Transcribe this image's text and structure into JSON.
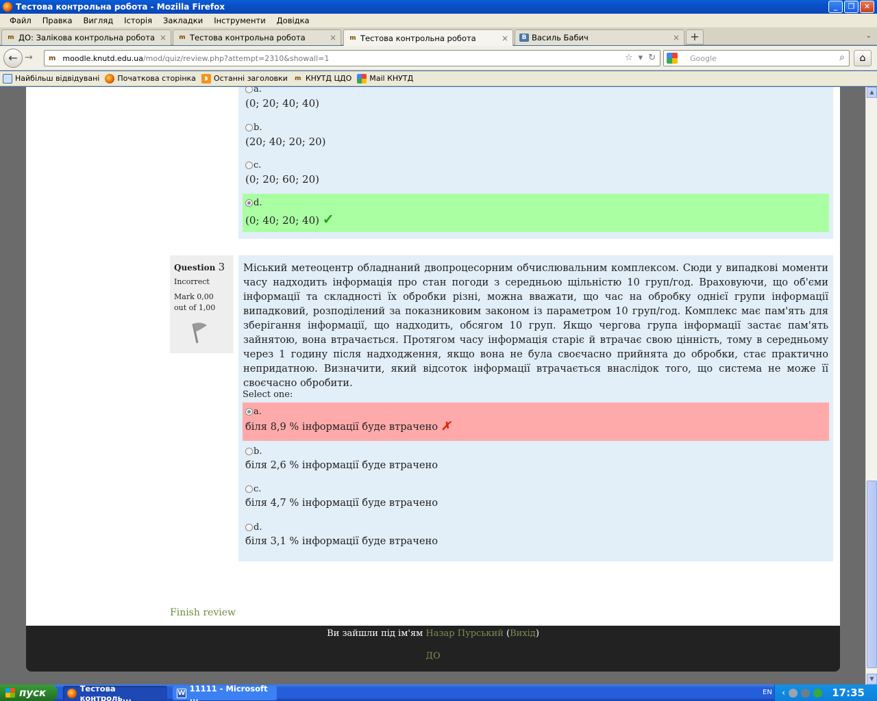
{
  "window": {
    "title": "Тестова контрольна робота - Mozilla Firefox",
    "buttons": [
      "_",
      "❐",
      "✕"
    ]
  },
  "menu": [
    "Файл",
    "Правка",
    "Вигляд",
    "Історія",
    "Закладки",
    "Інструменти",
    "Довідка"
  ],
  "tabs": [
    {
      "label": "ДО: Залікова контрольна робота",
      "icon": "moodle-icon"
    },
    {
      "label": "Тестова контрольна робота",
      "icon": "moodle-icon"
    },
    {
      "label": "Тестова контрольна робота",
      "icon": "moodle-icon",
      "active": true
    },
    {
      "label": "Василь Бабич",
      "icon": "vk-icon"
    }
  ],
  "nav": {
    "url_host": "moodle.knutd.edu.ua",
    "url_path": "/mod/quiz/review.php?attempt=2310&showall=1",
    "search_placeholder": "Google"
  },
  "bookmarks": [
    "Найбільш відвідувані",
    "Початкова сторінка",
    "Останні заголовки",
    "КНУТД ЦДО",
    "Mail КНУТД"
  ],
  "question2": {
    "answers": [
      {
        "letter": "a.",
        "text": "(0; 20; 40; 40)",
        "state": "none"
      },
      {
        "letter": "b.",
        "text": "(20; 40; 20; 20)",
        "state": "none"
      },
      {
        "letter": "c.",
        "text": "(0; 20; 60; 20)",
        "state": "none"
      },
      {
        "letter": "d.",
        "text": "(0; 40; 20; 40)",
        "state": "correct"
      }
    ],
    "tick": "✓"
  },
  "question3": {
    "label": "Question",
    "number": "3",
    "state": "Incorrect",
    "mark_line1": "Mark 0,00",
    "mark_line2": "out of 1,00",
    "text": "Міський метеоцентр обладнаний двопроцесорним обчислювальним комплексом. Сюди у випадкові моменти часу надходить інформація про стан погоди з середньою щільністю 10 груп/год. Враховуючи, що об'єми інформації та складності їх обробки різні, можна вважати, що час на обробку однієї групи інформації випадковий, розподілений за показниковим законом із параметром 10 груп/год. Комплекс має пам'ять для зберігання інформації, що надходить, обсягом 10 груп. Якщо чергова група інформації застає пам'ять зайнятою, вона втрачається. Протягом часу інформація старіє й втрачає свою цінність, тому в середньому через 1 годину після надходження, якщо вона не була своєчасно прийнята до обробки, стає практично непридатною. Визначити, який відсоток інформації втрачається внаслідок того, що система не може її своєчасно обробити.",
    "select_one": "Select one:",
    "answers": [
      {
        "letter": "a.",
        "text": "біля 8,9 % інформації буде втрачено",
        "state": "incorrect"
      },
      {
        "letter": "b.",
        "text": "біля 2,6 % інформації буде втрачено",
        "state": "none"
      },
      {
        "letter": "c.",
        "text": "біля 4,7 % інформації буде втрачено",
        "state": "none"
      },
      {
        "letter": "d.",
        "text": "біля 3,1 % інформації буде втрачено",
        "state": "none"
      }
    ],
    "cross": "✗"
  },
  "finish_review": "Finish review",
  "footer": {
    "logged_in_as": "Ви зайшли під ім'ям",
    "user": "Назар Пурський",
    "logout": "Вихід",
    "home_link": "ДО"
  },
  "taskbar": {
    "start": "пуск",
    "tasks": [
      "Тестова контроль...",
      "11111 - Microsoft ..."
    ],
    "lang": "EN",
    "clock": "17:35"
  }
}
